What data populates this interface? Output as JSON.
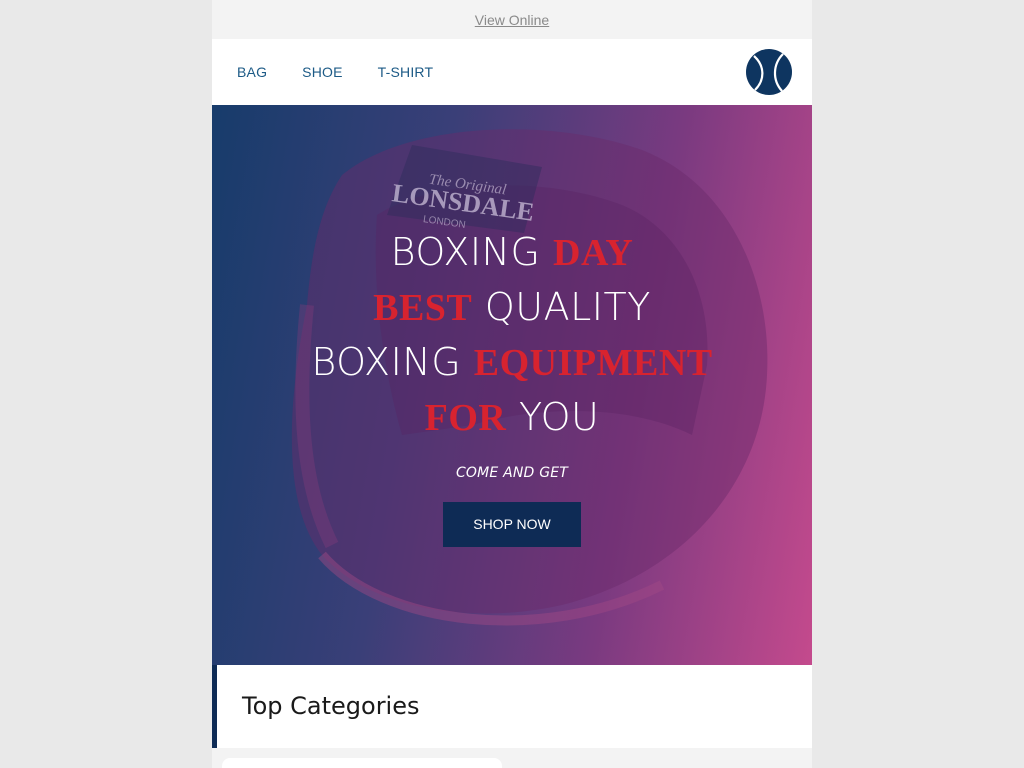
{
  "preheader": {
    "view_online": "View Online"
  },
  "nav": {
    "items": [
      {
        "label": "BAG"
      },
      {
        "label": "SHOE"
      },
      {
        "label": "T-SHIRT"
      }
    ],
    "logo_icon": "tennis-ball-icon"
  },
  "hero": {
    "lines": [
      {
        "plain": "BOXING",
        "accent": "DAY"
      },
      {
        "accent": "BEST",
        "plain": "QUALITY"
      },
      {
        "plain": "BOXING",
        "accent": "EQUIPMENT"
      },
      {
        "accent": "FOR",
        "plain": "YOU"
      }
    ],
    "subheading": "COME AND GET",
    "cta_label": "SHOP NOW",
    "image_text": {
      "brand": "LONSDALE",
      "script": "The Original",
      "city": "LONDON"
    },
    "colors": {
      "accent": "#d8232f",
      "button": "#0e2b55"
    }
  },
  "categories": {
    "title": "Top Categories"
  },
  "colors": {
    "brand_blue": "#1c5a86",
    "navy": "#0e2b55"
  }
}
